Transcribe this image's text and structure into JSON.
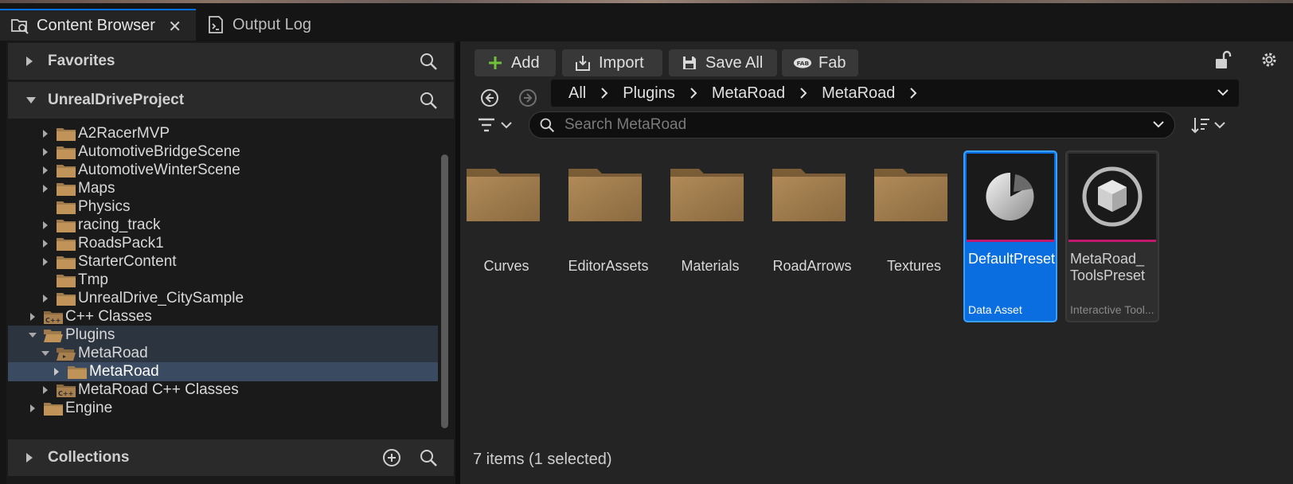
{
  "tabs": [
    {
      "label": "Content Browser",
      "active": true
    },
    {
      "label": "Output Log",
      "active": false
    }
  ],
  "sections": {
    "favorites": "Favorites",
    "project": "UnrealDriveProject",
    "collections": "Collections"
  },
  "tree": {
    "items": [
      {
        "label": "A2RacerMVP",
        "type": "folder"
      },
      {
        "label": "AutomotiveBridgeScene",
        "type": "folder"
      },
      {
        "label": "AutomotiveWinterScene",
        "type": "folder"
      },
      {
        "label": "Maps",
        "type": "folder"
      },
      {
        "label": "Physics",
        "type": "folder"
      },
      {
        "label": "racing_track",
        "type": "folder"
      },
      {
        "label": "RoadsPack1",
        "type": "folder"
      },
      {
        "label": "StarterContent",
        "type": "folder"
      },
      {
        "label": "Tmp",
        "type": "folder"
      },
      {
        "label": "UnrealDrive_CitySample",
        "type": "folder"
      },
      {
        "label": "C++ Classes",
        "type": "cpp"
      },
      {
        "label": "Plugins",
        "type": "open-folder"
      },
      {
        "label": "MetaRoad",
        "type": "plugin-folder"
      },
      {
        "label": "MetaRoad",
        "type": "folder"
      },
      {
        "label": "MetaRoad C++ Classes",
        "type": "cpp"
      },
      {
        "label": "Engine",
        "type": "folder"
      }
    ]
  },
  "toolbar": {
    "add": "Add",
    "import": "Import",
    "save_all": "Save All",
    "fab": "Fab"
  },
  "breadcrumb": [
    "All",
    "Plugins",
    "MetaRoad",
    "MetaRoad"
  ],
  "search": {
    "placeholder": "Search MetaRoad"
  },
  "folders": [
    "Curves",
    "EditorAssets",
    "Materials",
    "RoadArrows",
    "Textures"
  ],
  "assets": [
    {
      "name": "DefaultPreset",
      "type": "Data Asset",
      "selected": true
    },
    {
      "name": "MetaRoad_ ToolsPreset",
      "type": "Interactive Tool...",
      "selected": false
    }
  ],
  "status": "7 items (1 selected)",
  "colors": {
    "accent": "#0a6ee0",
    "folder": "#a07c4c",
    "asset_stripe": "#c0186a",
    "add_green": "#6fc23a"
  }
}
